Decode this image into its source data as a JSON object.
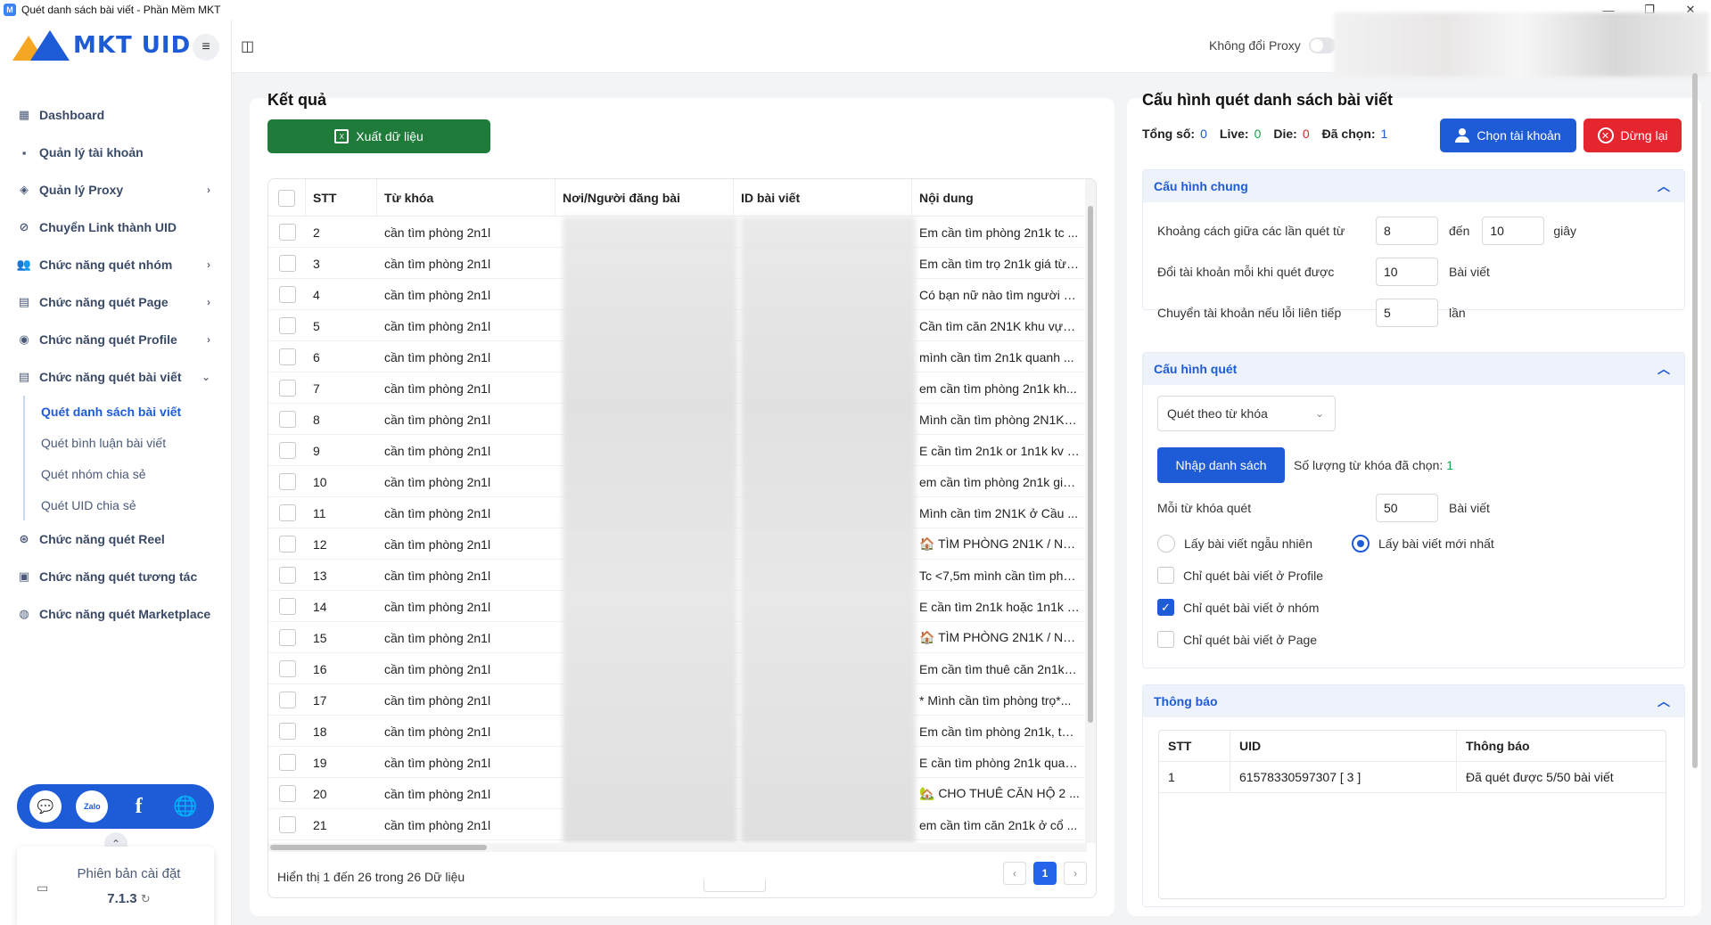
{
  "window": {
    "title": "Quét danh sách bài viết - Phần Mềm MKT",
    "controls": [
      "—",
      "❐",
      "✕"
    ]
  },
  "sidebar": {
    "logo_text": "MKT UID",
    "menu_icon": "hamburger-icon",
    "items": [
      {
        "label": "Dashboard",
        "icon": "dashboard-icon",
        "has_chevron": false
      },
      {
        "label": "Quản lý tài khoản",
        "icon": "grid-icon",
        "has_chevron": false
      },
      {
        "label": "Quản lý Proxy",
        "icon": "layers-icon",
        "has_chevron": true
      },
      {
        "label": "Chuyển Link thành UID",
        "icon": "link-icon",
        "has_chevron": false
      },
      {
        "label": "Chức năng quét nhóm",
        "icon": "group-icon",
        "has_chevron": true
      },
      {
        "label": "Chức năng quét Page",
        "icon": "page-icon",
        "has_chevron": true
      },
      {
        "label": "Chức năng quét Profile",
        "icon": "profile-icon",
        "has_chevron": true
      },
      {
        "label": "Chức năng quét bài viết",
        "icon": "post-icon",
        "has_chevron": true,
        "expanded": true
      }
    ],
    "subitems": [
      {
        "label": "Quét danh sách bài viết",
        "active": true
      },
      {
        "label": "Quét bình luận bài viết",
        "active": false
      },
      {
        "label": "Quét nhóm chia sẻ",
        "active": false
      },
      {
        "label": "Quét UID chia sẻ",
        "active": false
      }
    ],
    "items_after": [
      {
        "label": "Chức năng quét Reel",
        "icon": "reel-icon"
      },
      {
        "label": "Chức năng quét tương tác",
        "icon": "interaction-icon"
      },
      {
        "label": "Chức năng quét Marketplace",
        "icon": "marketplace-icon"
      }
    ],
    "social": [
      "support-icon",
      "zalo-icon",
      "facebook-icon",
      "globe-icon"
    ],
    "social_text": {
      "zalo": "Zalo",
      "facebook": "f",
      "globe": "🌐",
      "support": "💬"
    },
    "version_label": "Phiên bản cài đặt",
    "version": "7.1.3"
  },
  "topbar": {
    "proxy_label": "Không đổi Proxy",
    "proxy_enabled": false
  },
  "results": {
    "title": "Kết quả",
    "export_label": "Xuất dữ liệu",
    "columns": [
      "STT",
      "Từ khóa",
      "Nơi/Người đăng bài",
      "ID bài viết",
      "Nội dung"
    ],
    "rows": [
      {
        "stt": "2",
        "keyword": "cần tìm phòng 2n1l",
        "content": "Em cần tìm phòng 2n1k tc ..."
      },
      {
        "stt": "3",
        "keyword": "cần tìm phòng 2n1l",
        "content": "Em cần tìm trọ 2n1k giá từ ..."
      },
      {
        "stt": "4",
        "keyword": "cần tìm phòng 2n1l",
        "content": "Có bạn nữ nào tìm người ở..."
      },
      {
        "stt": "5",
        "keyword": "cần tìm phòng 2n1l",
        "content": "Cần tìm căn 2N1K khu vực ..."
      },
      {
        "stt": "6",
        "keyword": "cần tìm phòng 2n1l",
        "content": "mình cần tìm 2n1k quanh ..."
      },
      {
        "stt": "7",
        "keyword": "cần tìm phòng 2n1l",
        "content": "em cần tìm phòng 2n1k kh..."
      },
      {
        "stt": "8",
        "keyword": "cần tìm phòng 2n1l",
        "content": "Mình cần tìm phòng 2N1K, ..."
      },
      {
        "stt": "9",
        "keyword": "cần tìm phòng 2n1l",
        "content": "E cần tìm 2n1k or 1n1k kv C..."
      },
      {
        "stt": "10",
        "keyword": "cần tìm phòng 2n1l",
        "content": "em cần tìm phòng 2n1k giá..."
      },
      {
        "stt": "11",
        "keyword": "cần tìm phòng 2n1l",
        "content": "Mình cần tìm 2N1K ở Cầu ..."
      },
      {
        "stt": "12",
        "keyword": "cần tìm phòng 2n1l",
        "content": "🏠 TÌM PHÒNG 2N1K / NH..."
      },
      {
        "stt": "13",
        "keyword": "cần tìm phòng 2n1l",
        "content": "Tc <7,5m mình cần tìm phò..."
      },
      {
        "stt": "14",
        "keyword": "cần tìm phòng 2n1l",
        "content": "E cần tìm 2n1k hoặc 1n1k k..."
      },
      {
        "stt": "15",
        "keyword": "cần tìm phòng 2n1l",
        "content": "🏠 TÌM PHÒNG 2N1K / NH..."
      },
      {
        "stt": "16",
        "keyword": "cần tìm phòng 2n1l",
        "content": "Em cần tìm thuê căn 2n1k, ..."
      },
      {
        "stt": "17",
        "keyword": "cần tìm phòng 2n1l",
        "content": "* Mình cần tìm phòng trọ*..."
      },
      {
        "stt": "18",
        "keyword": "cần tìm phòng 2n1l",
        "content": "Em cần tìm phòng 2n1k, tài..."
      },
      {
        "stt": "19",
        "keyword": "cần tìm phòng 2n1l",
        "content": "E cần tìm phòng 2n1k quan..."
      },
      {
        "stt": "20",
        "keyword": "cần tìm phòng 2n1l",
        "content": "🏡 CHO THUÊ CĂN HỘ 2 ..."
      },
      {
        "stt": "21",
        "keyword": "cần tìm phòng 2n1l",
        "content": "em cần tìm căn 2n1k ở cổ ..."
      }
    ],
    "footer": "Hiển thị 1 đến 26 trong 26 Dữ liệu",
    "page_current": "1",
    "page_prev": "‹",
    "page_next": "›"
  },
  "config": {
    "title": "Cấu hình quét danh sách bài viết",
    "stats": {
      "total_label": "Tổng số:",
      "total": "0",
      "live_label": "Live:",
      "live": "0",
      "die_label": "Die:",
      "die": "0",
      "selected_label": "Đã chọn:",
      "selected": "1"
    },
    "choose_account_label": "Chọn tài khoản",
    "stop_label": "Dừng lại",
    "general": {
      "title": "Cấu hình chung",
      "interval_label": "Khoảng cách giữa các lần quét từ",
      "interval_from": "8",
      "interval_to_label": "đến",
      "interval_to": "10",
      "interval_unit": "giây",
      "switch_label": "Đổi tài khoản mỗi khi quét được",
      "switch_value": "10",
      "switch_unit": "Bài viết",
      "error_label": "Chuyển tài khoản nếu lỗi liên tiếp",
      "error_value": "5",
      "error_unit": "lần"
    },
    "scan": {
      "title": "Cấu hình quét",
      "mode": "Quét theo từ khóa",
      "import_label": "Nhập danh sách",
      "keyword_count_label": "Số lượng từ khóa đã chọn:",
      "keyword_count": "1",
      "per_keyword_label": "Mỗi từ khóa quét",
      "per_keyword_value": "50",
      "per_keyword_unit": "Bài viết",
      "random_label": "Lấy bài viết ngẫu nhiên",
      "newest_label": "Lấy bài viết mới nhất",
      "selected_radio": "newest",
      "only_profile_label": "Chỉ quét bài viết ở Profile",
      "only_profile": false,
      "only_group_label": "Chỉ quét bài viết ở nhóm",
      "only_group": true,
      "only_page_label": "Chỉ quét bài viết ở Page",
      "only_page": false
    },
    "notice": {
      "title": "Thông báo",
      "columns": [
        "STT",
        "UID",
        "Thông báo"
      ],
      "rows": [
        {
          "stt": "1",
          "uid": "61578330597307 [ 3 ]",
          "message": "Đã quét được 5/50 bài viết"
        }
      ]
    }
  }
}
